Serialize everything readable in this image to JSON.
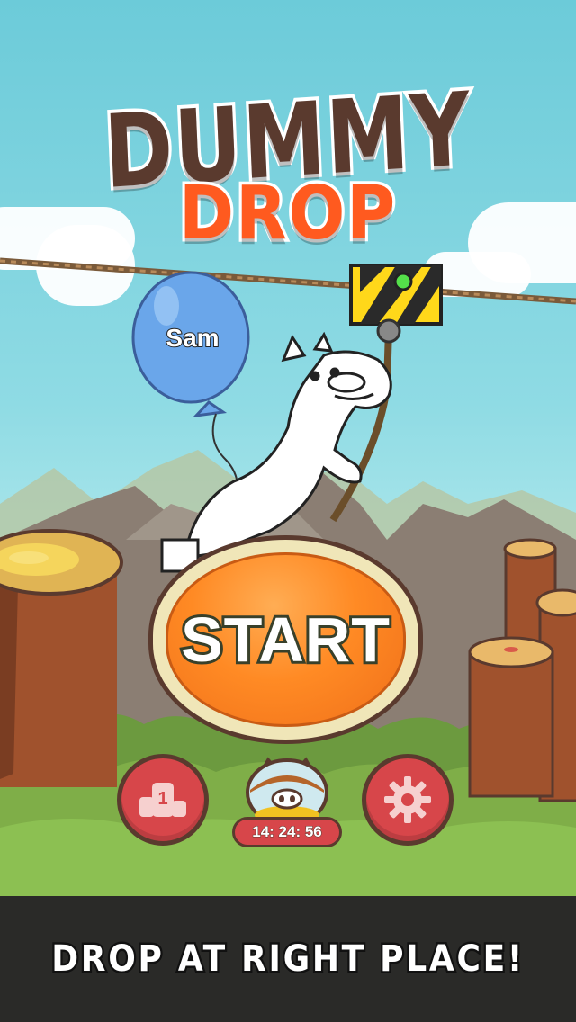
{
  "game": {
    "title_line1": "DUMMY",
    "title_line2": "DROP"
  },
  "character": {
    "balloon_name": "Sam",
    "balloon_color": "#6aa6ea"
  },
  "menu": {
    "start_label": "START",
    "leaderboard_icon": "podium-icon",
    "leaderboard_rank": "1",
    "piggy_bank_icon": "piggy-bank-icon",
    "piggy_bank_timer": "14: 24: 56",
    "settings_icon": "gear-icon"
  },
  "footer": {
    "tagline": "DROP AT RIGHT PLACE!"
  },
  "colors": {
    "accent_orange": "#ff8a24",
    "title_brown": "#5a3a2e",
    "title_orange": "#ff5a1f",
    "button_red": "#d7464a"
  }
}
